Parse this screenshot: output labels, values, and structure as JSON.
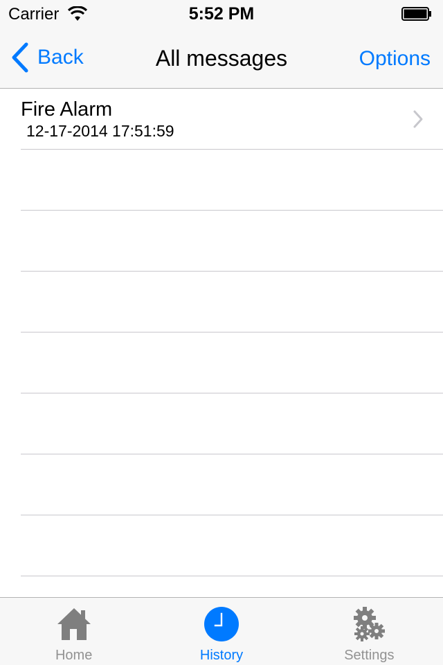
{
  "status_bar": {
    "carrier": "Carrier",
    "time": "5:52 PM"
  },
  "nav": {
    "back_label": "Back",
    "title": "All messages",
    "options_label": "Options"
  },
  "messages": [
    {
      "title": "Fire Alarm",
      "timestamp": "12-17-2014 17:51:59"
    }
  ],
  "tabs": [
    {
      "label": "Home",
      "icon": "home-icon",
      "active": false
    },
    {
      "label": "History",
      "icon": "clock-icon",
      "active": true
    },
    {
      "label": "Settings",
      "icon": "gears-icon",
      "active": false
    }
  ],
  "colors": {
    "accent": "#007aff",
    "inactive_tab": "#929292",
    "bar_background": "#f7f7f7"
  }
}
